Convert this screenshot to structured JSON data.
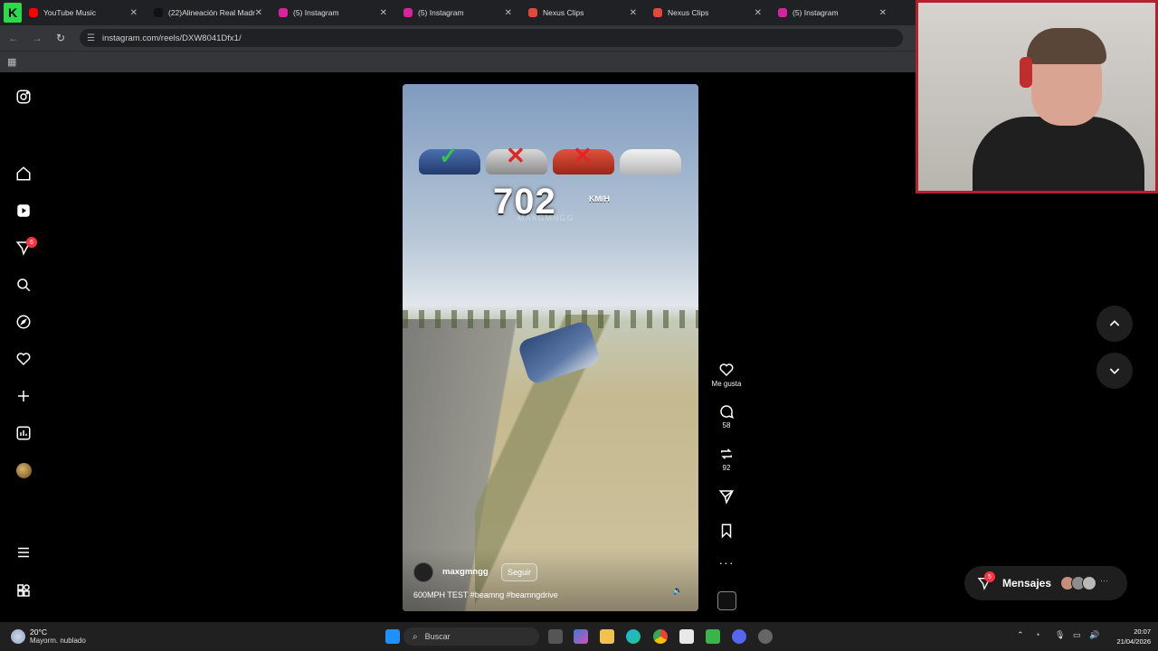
{
  "browser": {
    "tabs": [
      {
        "label": "YouTube Music",
        "color": "#ff0000"
      },
      {
        "label": "(22)Alineación Real Madr",
        "color": "#111111"
      },
      {
        "label": "(5) Instagram",
        "color": "#d6249f"
      },
      {
        "label": "(5) Instagram",
        "color": "#d6249f"
      },
      {
        "label": "Nexus Clips",
        "color": "#e04a3c"
      },
      {
        "label": "Nexus Clips",
        "color": "#e04a3c"
      },
      {
        "label": "(5) Instagram",
        "color": "#d6249f"
      }
    ],
    "k_badge": "K",
    "url": "instagram.com/reels/DXW8041Dfx1/"
  },
  "sidebar": {
    "items": [
      "instagram-logo-icon",
      "home-icon",
      "reels-icon",
      "messages-icon",
      "search-icon",
      "explore-icon",
      "notifications-icon",
      "create-icon",
      "dashboard-icon",
      "profile-avatar",
      "menu-icon",
      "more-apps-icon"
    ],
    "messages_badge": "6"
  },
  "video": {
    "speed": "702",
    "speed_unit": "KM/H",
    "watermark": "MAXGMNGG",
    "username": "maxgmngg",
    "follow_label": "Seguir",
    "caption": "600MPH TEST #beamng #beamngdrive"
  },
  "actions": {
    "like_label": "Me gusta",
    "comments": "58",
    "reposts": "92"
  },
  "messages": {
    "label": "Mensajes",
    "badge": "5"
  },
  "taskbar": {
    "temperature": "20°C",
    "weather": "Mayorm. nublado",
    "search_placeholder": "Buscar",
    "time": "20:07",
    "date": "21/04/2026"
  }
}
